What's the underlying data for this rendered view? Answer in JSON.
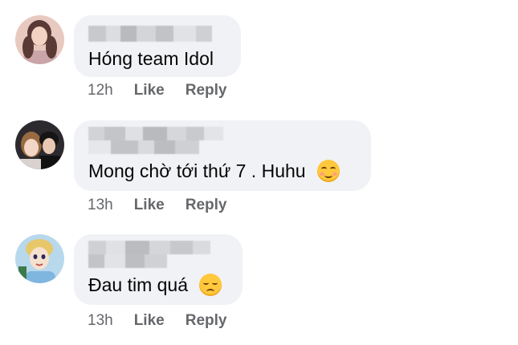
{
  "comments": [
    {
      "text": "Hóng team Idol",
      "emoji": "",
      "time": "12h",
      "like_label": "Like",
      "reply_label": "Reply"
    },
    {
      "text": "Mong chờ tới thứ 7 . Huhu",
      "emoji": "relieved-face",
      "time": "13h",
      "like_label": "Like",
      "reply_label": "Reply"
    },
    {
      "text": "Đau tim quá",
      "emoji": "disappointed-face",
      "time": "13h",
      "like_label": "Like",
      "reply_label": "Reply"
    }
  ],
  "colors": {
    "bubble_bg": "#f0f2f5",
    "text": "#050505",
    "secondary_text": "#65676b"
  }
}
